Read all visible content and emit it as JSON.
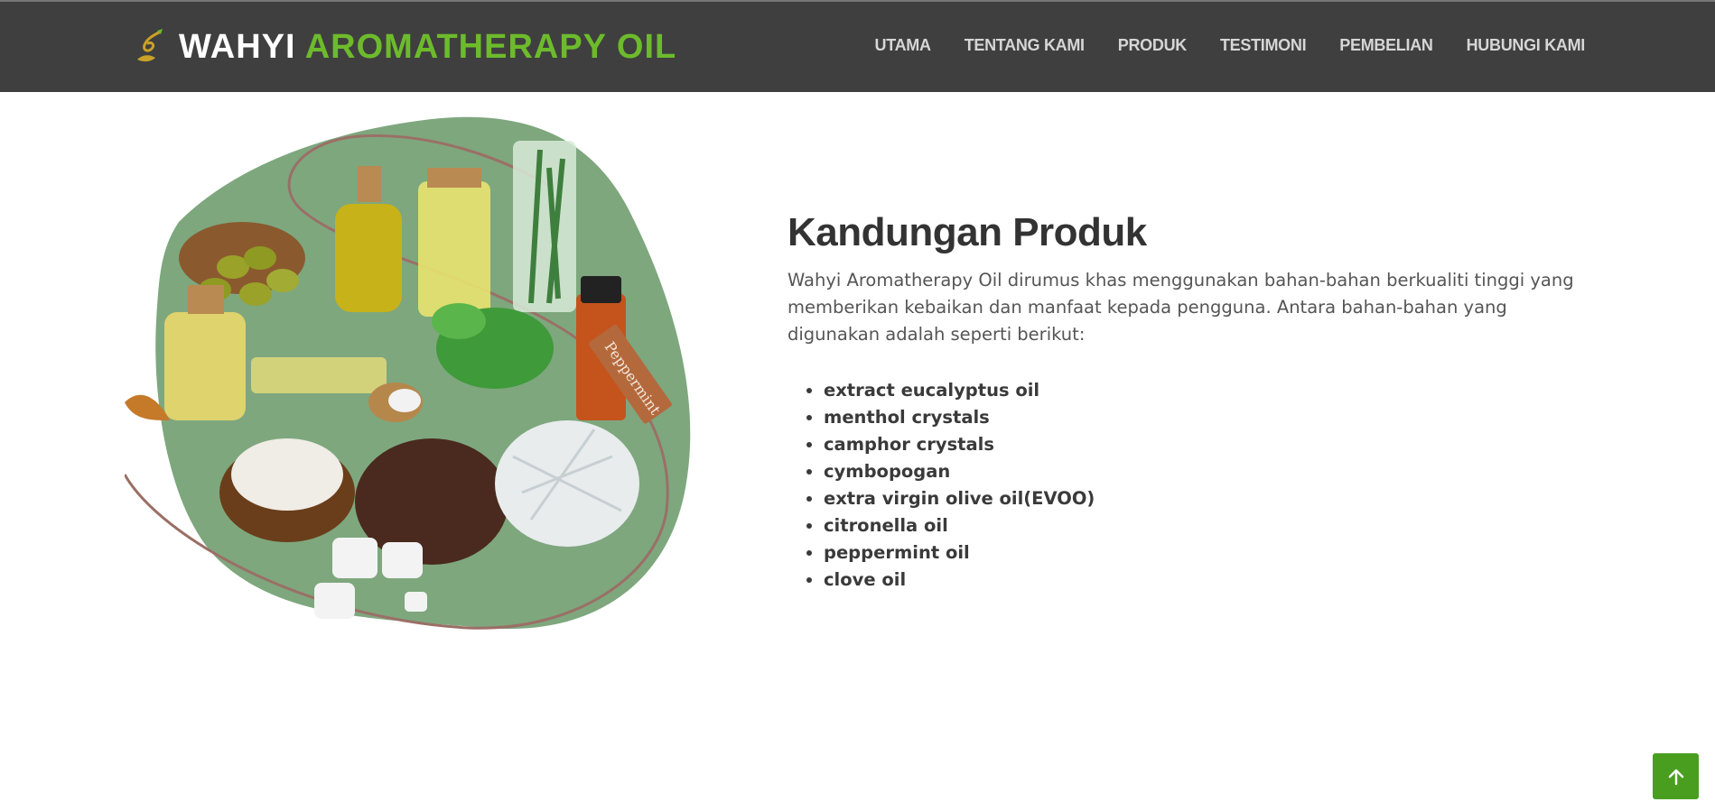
{
  "header": {
    "brand_main": "WAHYI",
    "brand_accent": "AROMATHERAPY OIL",
    "logo_icon": "leaf-swirl-logo",
    "nav": [
      {
        "label": "UTAMA"
      },
      {
        "label": "TENTANG KAMI"
      },
      {
        "label": "PRODUK"
      },
      {
        "label": "TESTIMONI"
      },
      {
        "label": "PEMBELIAN"
      },
      {
        "label": "HUBUNGI KAMI"
      }
    ]
  },
  "main": {
    "title": "Kandungan Produk",
    "description": "Wahyi Aromatherapy Oil dirumus khas menggunakan bahan-bahan berkualiti tinggi yang memberikan kebaikan dan manfaat kepada pengguna. Antara bahan-bahan yang digunakan adalah seperti berikut:",
    "ingredients": [
      "extract eucalyptus oil",
      "menthol crystals",
      "camphor crystals",
      "cymbopogan",
      "extra virgin olive oil(EVOO)",
      "citronella oil",
      "peppermint oil",
      "clove oil"
    ],
    "image_tag_text": "Peppermint"
  },
  "back_to_top": {
    "icon": "arrow-up-icon"
  },
  "colors": {
    "header_bg": "#3f3f3f",
    "accent": "#6dbb2c",
    "blob": "#7ea77e",
    "button": "#4a9e1f"
  }
}
